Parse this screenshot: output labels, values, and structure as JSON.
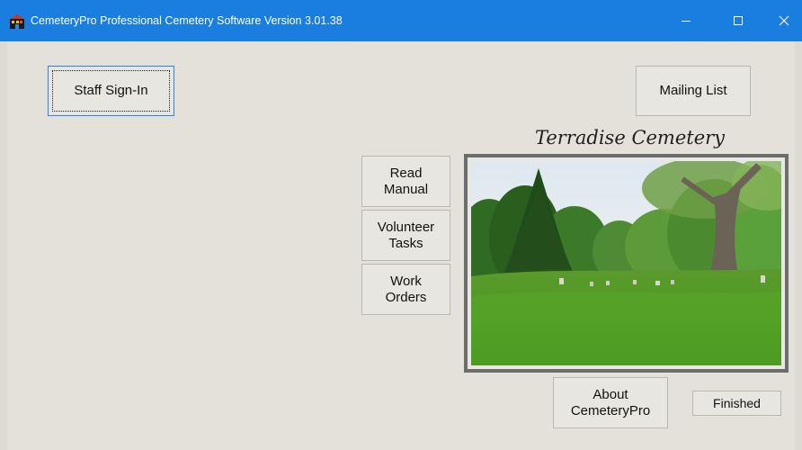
{
  "window": {
    "title": "CemeteryPro Professional Cemetery Software Version 3.01.38",
    "controls": {
      "minimize": "minimize-icon",
      "maximize": "maximize-icon",
      "close": "close-icon"
    }
  },
  "buttons": {
    "staff_sign_in": "Staff Sign-In",
    "mailing_list": "Mailing List",
    "read_manual": "Read\nManual",
    "volunteer_tasks": "Volunteer\nTasks",
    "work_orders": "Work\nOrders",
    "about": "About\nCemeteryPro",
    "finished": "Finished"
  },
  "cemetery": {
    "name": "Terradise Cemetery"
  },
  "colors": {
    "titlebar": "#1a7ee0",
    "window_bg": "#e3e1da",
    "frame": "#6d6d6d"
  }
}
